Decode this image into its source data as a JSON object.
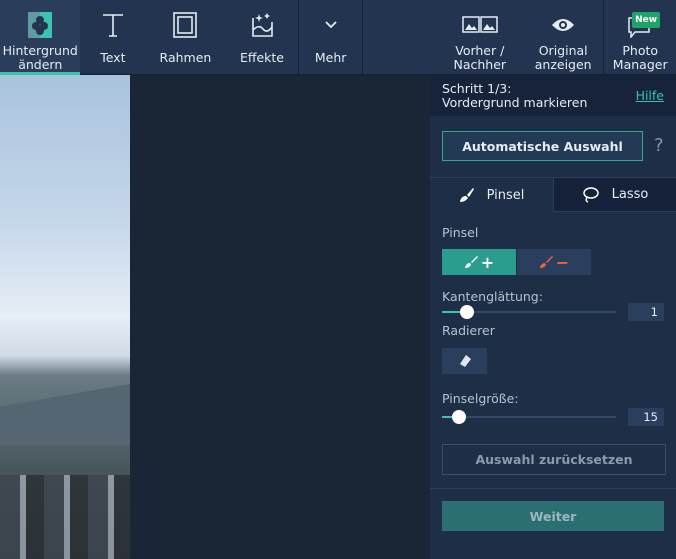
{
  "toolbar": {
    "items": [
      {
        "label1": "Hintergrund",
        "label2": "ändern"
      },
      {
        "label1": "Text"
      },
      {
        "label1": "Rahmen"
      },
      {
        "label1": "Effekte"
      },
      {
        "label1": "Mehr"
      },
      {
        "label1": "Vorher /",
        "label2": "Nachher"
      },
      {
        "label1": "Original",
        "label2": "anzeigen"
      },
      {
        "label1": "Photo",
        "label2": "Manager",
        "badge": "New"
      }
    ]
  },
  "panel": {
    "step_line1": "Schritt 1/3:",
    "step_line2": "Vordergrund markieren",
    "help": "Hilfe",
    "auto_select": "Automatische Auswahl",
    "question": "?",
    "tabs": [
      "Pinsel",
      "Lasso"
    ],
    "brush_label": "Pinsel",
    "brush_add": "+",
    "brush_remove": "−",
    "smoothing_label": "Kantenglättung:",
    "smoothing_value": "1",
    "smoothing_fraction": 0.05,
    "eraser_label": "Radierer",
    "brush_size_label": "Pinselgröße:",
    "brush_size_value": "15",
    "brush_size_fraction": 0.03,
    "reset": "Auswahl zurücksetzen",
    "next": "Weiter"
  },
  "colors": {
    "accent": "#3cc2ad",
    "remove": "#f0643c"
  }
}
